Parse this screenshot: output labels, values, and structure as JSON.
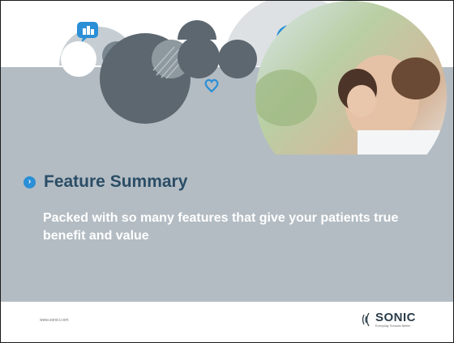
{
  "slide": {
    "title": "Feature Summary",
    "subtitle": "Packed with so many features that give your patients true benefit and value",
    "website": "www.sonici.com"
  },
  "brand": {
    "name": "SONIC",
    "tagline": "Everyday Sounds Better"
  },
  "icons": [
    "building-icon",
    "car-icon",
    "heart-icon",
    "dotted-circle-icon",
    "arrow-bullet-icon",
    "sound-wave-icon"
  ],
  "colors": {
    "band": "#b3bcc3",
    "title": "#2b4d66",
    "bullet": "#2a8fd6",
    "circle_dark": "#5c6770",
    "circle_blue": "#2a8fd6"
  }
}
